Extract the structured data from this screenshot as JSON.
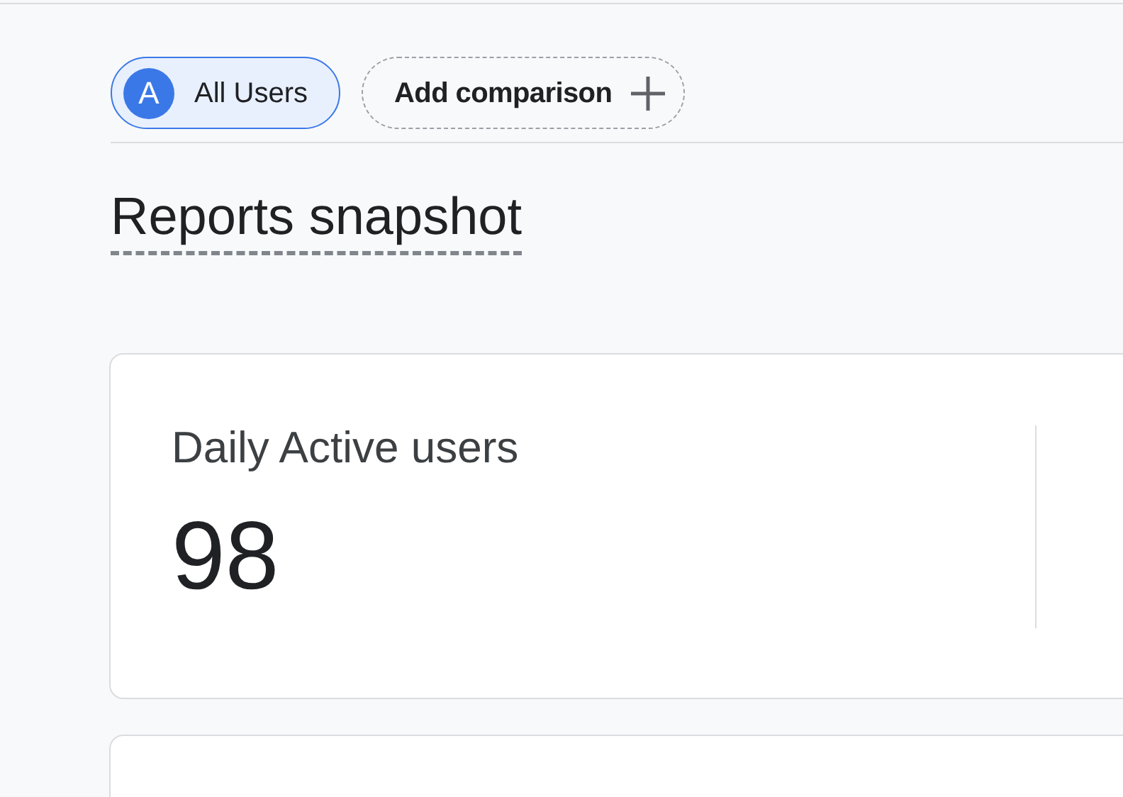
{
  "segments": [
    {
      "avatar": "A",
      "label": "All Users",
      "selected": true
    }
  ],
  "add_comparison": {
    "label": "Add comparison"
  },
  "title": "Reports snapshot",
  "cards": [
    {
      "label": "Daily Active users",
      "value": "98"
    }
  ]
}
